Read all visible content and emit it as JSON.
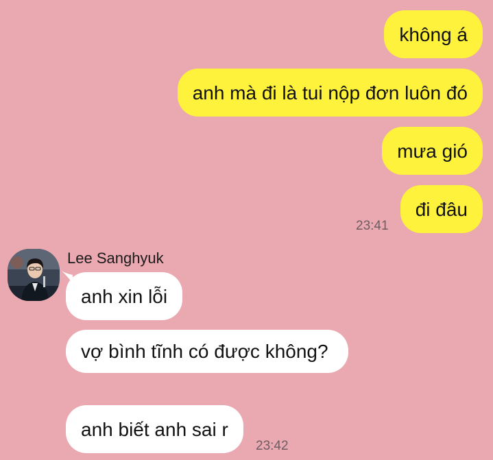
{
  "outgoing": {
    "messages": [
      {
        "text": "không á"
      },
      {
        "text": "anh mà đi là tui nộp đơn luôn đó"
      },
      {
        "text": "mưa gió"
      },
      {
        "text": "đi đâu"
      }
    ],
    "timestamp": "23:41",
    "bubble_color": "#fef23c"
  },
  "incoming": {
    "sender_name": "Lee Sanghyuk",
    "avatar_icon": "profile-photo",
    "messages": [
      {
        "text": "anh xin lỗi"
      },
      {
        "text": "vợ bình tĩnh có được không?"
      },
      {
        "text": "anh biết anh sai r"
      }
    ],
    "timestamp": "23:42",
    "bubble_color": "#ffffff"
  },
  "chat": {
    "background_color": "#eaa8b0"
  }
}
